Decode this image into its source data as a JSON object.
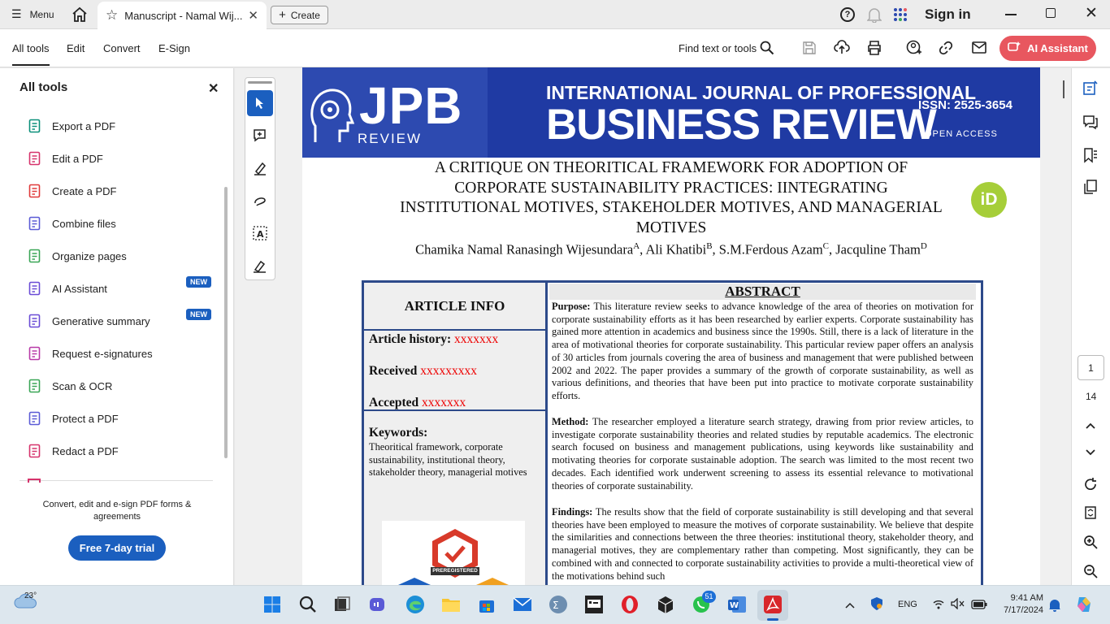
{
  "titlebar": {
    "menu_label": "Menu",
    "tab_title": "Manuscript - Namal Wij...",
    "create_label": "Create",
    "signin_label": "Sign in"
  },
  "toolbar": {
    "menus": [
      "All tools",
      "Edit",
      "Convert",
      "E-Sign"
    ],
    "find_label": "Find text or tools",
    "ai_assistant_label": "AI Assistant"
  },
  "left_panel": {
    "title": "All tools",
    "tools": [
      {
        "label": "Export a PDF",
        "icon": "export-pdf-icon",
        "color": "#0a8f7a"
      },
      {
        "label": "Edit a PDF",
        "icon": "edit-pdf-icon",
        "color": "#d6336c"
      },
      {
        "label": "Create a PDF",
        "icon": "create-pdf-icon",
        "color": "#e03a3a"
      },
      {
        "label": "Combine files",
        "icon": "combine-files-icon",
        "color": "#5b5bd6"
      },
      {
        "label": "Organize pages",
        "icon": "organize-pages-icon",
        "color": "#3aa657"
      },
      {
        "label": "AI Assistant",
        "icon": "ai-assistant-icon",
        "color": "#6a4cd6",
        "badge": "NEW"
      },
      {
        "label": "Generative summary",
        "icon": "generative-summary-icon",
        "color": "#6a4cd6",
        "badge": "NEW"
      },
      {
        "label": "Request e-signatures",
        "icon": "request-esignatures-icon",
        "color": "#b83aa8"
      },
      {
        "label": "Scan & OCR",
        "icon": "scan-ocr-icon",
        "color": "#3aa657"
      },
      {
        "label": "Protect a PDF",
        "icon": "protect-pdf-icon",
        "color": "#5b5bd6"
      },
      {
        "label": "Redact a PDF",
        "icon": "redact-pdf-icon",
        "color": "#d6336c"
      }
    ],
    "footer_text": "Convert, edit and e-sign PDF forms & agreements",
    "trial_label": "Free 7-day trial"
  },
  "document": {
    "banner": {
      "logo_text": "JPB",
      "logo_sub": "REVIEW",
      "journal_line1": "INTERNATIONAL JOURNAL OF PROFESSIONAL",
      "journal_line2": "BUSINESS REVIEW",
      "issn": "ISSN: 2525-3654",
      "open_access": "OPEN ACCESS"
    },
    "title": "A CRITIQUE ON THEORITICAL FRAMEWORK FOR ADOPTION OF CORPORATE SUSTAINABILITY PRACTICES: IINTEGRATING INSTITUTIONAL MOTIVES, STAKEHOLDER MOTIVES, AND MANAGERIAL MOTIVES",
    "authors_line1": "Chamika Namal Ranasingh Wijesundara",
    "authors_line2": "Tham",
    "author_parts": [
      {
        "name": "Chamika Namal Ranasingh Wijesundara",
        "sup": "A"
      },
      {
        "name": ", Ali Khatibi",
        "sup": "B"
      },
      {
        "name": ", S.M.Ferdous Azam",
        "sup": "C"
      },
      {
        "name": ", Jacquline Tham",
        "sup": "D"
      }
    ],
    "orcid": "iD",
    "article_info": {
      "heading": "ARTICLE INFO",
      "history_label": "Article history:",
      "history_value": "xxxxxxx",
      "received_label": "Received",
      "received_value": "xxxxxxxxx",
      "accepted_label": "Accepted",
      "accepted_value": "xxxxxxx",
      "keywords_label": "Keywords:",
      "keywords_text": "Theoritical framework, corporate sustainability, institutional theory, stakeholder theory, managerial motives",
      "prereg_label": "PREREGISTERED"
    },
    "abstract": {
      "heading": "ABSTRACT",
      "purpose_label": "Purpose:",
      "purpose_text": " This literature review seeks to advance knowledge of the area of theories on motivation for corporate sustainability efforts as it has been researched by earlier experts. Corporate sustainability has gained more attention in academics and business since the 1990s. Still, there is a lack of literature in the area of motivational theories for corporate sustainability. This particular review paper offers an analysis of 30 articles from journals covering the area of business and management that were published between 2002 and 2022. The paper provides a summary of the growth of corporate sustainability, as well as various definitions, and theories that have been put into practice to motivate corporate sustainability efforts.",
      "method_label": "Method:",
      "method_text": "  The researcher employed a literature search strategy, drawing from prior review articles, to investigate corporate sustainability theories and related studies by reputable academics. The electronic search focused on business and management publications, using keywords like sustainability and motivating theories for corporate sustainable adoption. The search was limited to the most recent two decades. Each identified work underwent screening to assess its essential relevance to motivational theories of corporate sustainability.",
      "findings_label": "Findings:",
      "findings_text": " The results show that the field of corporate sustainability is still developing and that several theories have been employed to measure the motives of corporate sustainability. We believe that despite the similarities and connections between the three theories: institutional theory, stakeholder theory, and managerial motives, they are complementary rather than competing. Most significantly, they can be combined with and connected to corporate sustainability activities to provide a multi-theoretical view of the motivations behind such"
    }
  },
  "page_nav": {
    "current": "1",
    "total": "14"
  },
  "taskbar": {
    "weather": "23°",
    "whatsapp_badge": "51",
    "language": "ENG",
    "time": "9:41 AM",
    "date": "7/17/2024"
  }
}
